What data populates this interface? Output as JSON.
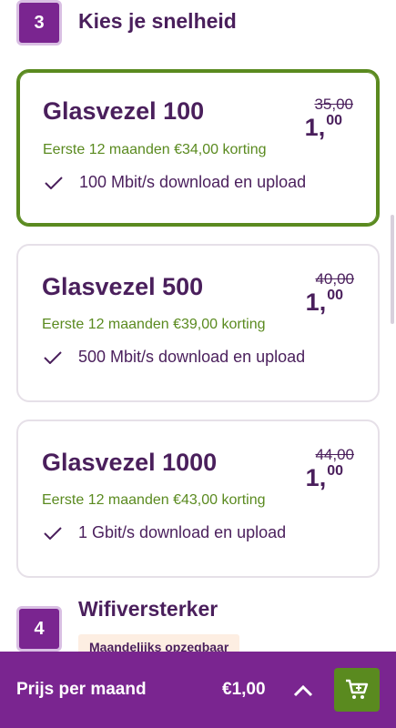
{
  "step3": {
    "number": "3",
    "title": "Kies je snelheid"
  },
  "plans": [
    {
      "name": "Glasvezel 100",
      "old_price": "35,00",
      "new_price_main": "1,",
      "new_price_cents": "00",
      "discount": "Eerste 12 maanden €34,00 korting",
      "feature": "100 Mbit/s download en upload",
      "selected": true
    },
    {
      "name": "Glasvezel 500",
      "old_price": "40,00",
      "new_price_main": "1,",
      "new_price_cents": "00",
      "discount": "Eerste 12 maanden €39,00 korting",
      "feature": "500 Mbit/s download en upload",
      "selected": false
    },
    {
      "name": "Glasvezel 1000",
      "old_price": "44,00",
      "new_price_main": "1,",
      "new_price_cents": "00",
      "discount": "Eerste 12 maanden €43,00 korting",
      "feature": "1 Gbit/s download en upload",
      "selected": false
    }
  ],
  "step4": {
    "number": "4",
    "title": "Wifiversterker",
    "badge": "Maandelijks opzegbaar"
  },
  "bottom_bar": {
    "label": "Prijs per maand",
    "price": "€1,00"
  },
  "colors": {
    "brand_purple": "#7a2590",
    "text_purple": "#4a1f5c",
    "accent_green": "#5a8a1f"
  },
  "icons": {
    "check": "check-icon",
    "chevron": "chevron-up-icon",
    "cart": "cart-icon"
  }
}
